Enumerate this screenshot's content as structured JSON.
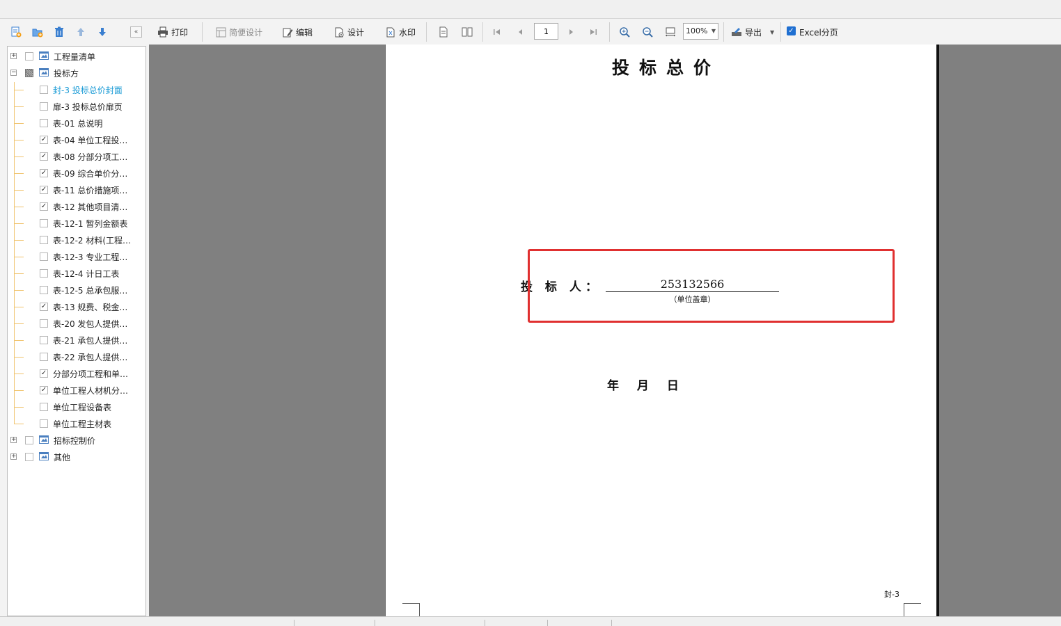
{
  "sidebar": {
    "toolbar_icons": [
      "add-report-icon",
      "add-folder-icon",
      "delete-icon",
      "move-up-icon",
      "move-down-icon"
    ],
    "collapse_label": "«",
    "tree": [
      {
        "label": "工程量清单",
        "level": 0,
        "expander": "+",
        "checked": false
      },
      {
        "label": "投标方",
        "level": 0,
        "expander": "−",
        "checked": "partial"
      },
      {
        "label": "封-3 投标总价封面",
        "level": 1,
        "checked": false,
        "selected": true
      },
      {
        "label": "扉-3 投标总价扉页",
        "level": 1,
        "checked": false
      },
      {
        "label": "表-01 总说明",
        "level": 1,
        "checked": false
      },
      {
        "label": "表-04 单位工程投…",
        "level": 1,
        "checked": true
      },
      {
        "label": "表-08 分部分项工…",
        "level": 1,
        "checked": true
      },
      {
        "label": "表-09 综合单价分…",
        "level": 1,
        "checked": true
      },
      {
        "label": "表-11 总价措施项…",
        "level": 1,
        "checked": true
      },
      {
        "label": "表-12 其他项目清…",
        "level": 1,
        "checked": true
      },
      {
        "label": "表-12-1 暂列金额表",
        "level": 1,
        "checked": false
      },
      {
        "label": "表-12-2 材料(工程…",
        "level": 1,
        "checked": false
      },
      {
        "label": "表-12-3 专业工程…",
        "level": 1,
        "checked": false
      },
      {
        "label": "表-12-4 计日工表",
        "level": 1,
        "checked": false
      },
      {
        "label": "表-12-5 总承包服…",
        "level": 1,
        "checked": false
      },
      {
        "label": "表-13 规费、税金…",
        "level": 1,
        "checked": true
      },
      {
        "label": "表-20 发包人提供…",
        "level": 1,
        "checked": false
      },
      {
        "label": "表-21 承包人提供…",
        "level": 1,
        "checked": false
      },
      {
        "label": "表-22 承包人提供…",
        "level": 1,
        "checked": false
      },
      {
        "label": "分部分项工程和单…",
        "level": 1,
        "checked": true
      },
      {
        "label": "单位工程人材机分…",
        "level": 1,
        "checked": true
      },
      {
        "label": "单位工程设备表",
        "level": 1,
        "checked": false
      },
      {
        "label": "单位工程主材表",
        "level": 1,
        "checked": false
      },
      {
        "label": "招标控制价",
        "level": 0,
        "expander": "+",
        "checked": false
      },
      {
        "label": "其他",
        "level": 0,
        "expander": "+",
        "checked": false
      }
    ]
  },
  "toolbar": {
    "print": "打印",
    "simple_design": "简便设计",
    "edit": "编辑",
    "design": "设计",
    "watermark": "水印",
    "page_number": "1",
    "zoom": "100%",
    "export": "导出",
    "excel_paging": "Excel分页",
    "excel_paging_checked": true
  },
  "document": {
    "title": "投标总价",
    "bidder_label": "投 标 人：",
    "bidder_value": "253132566",
    "bidder_note": "（单位盖章）",
    "date_line": "年 月 日",
    "page_code": "封-3"
  },
  "colors": {
    "selected_text": "#1a9bd6",
    "highlight_box": "#e03030",
    "preview_bg": "#808080"
  }
}
